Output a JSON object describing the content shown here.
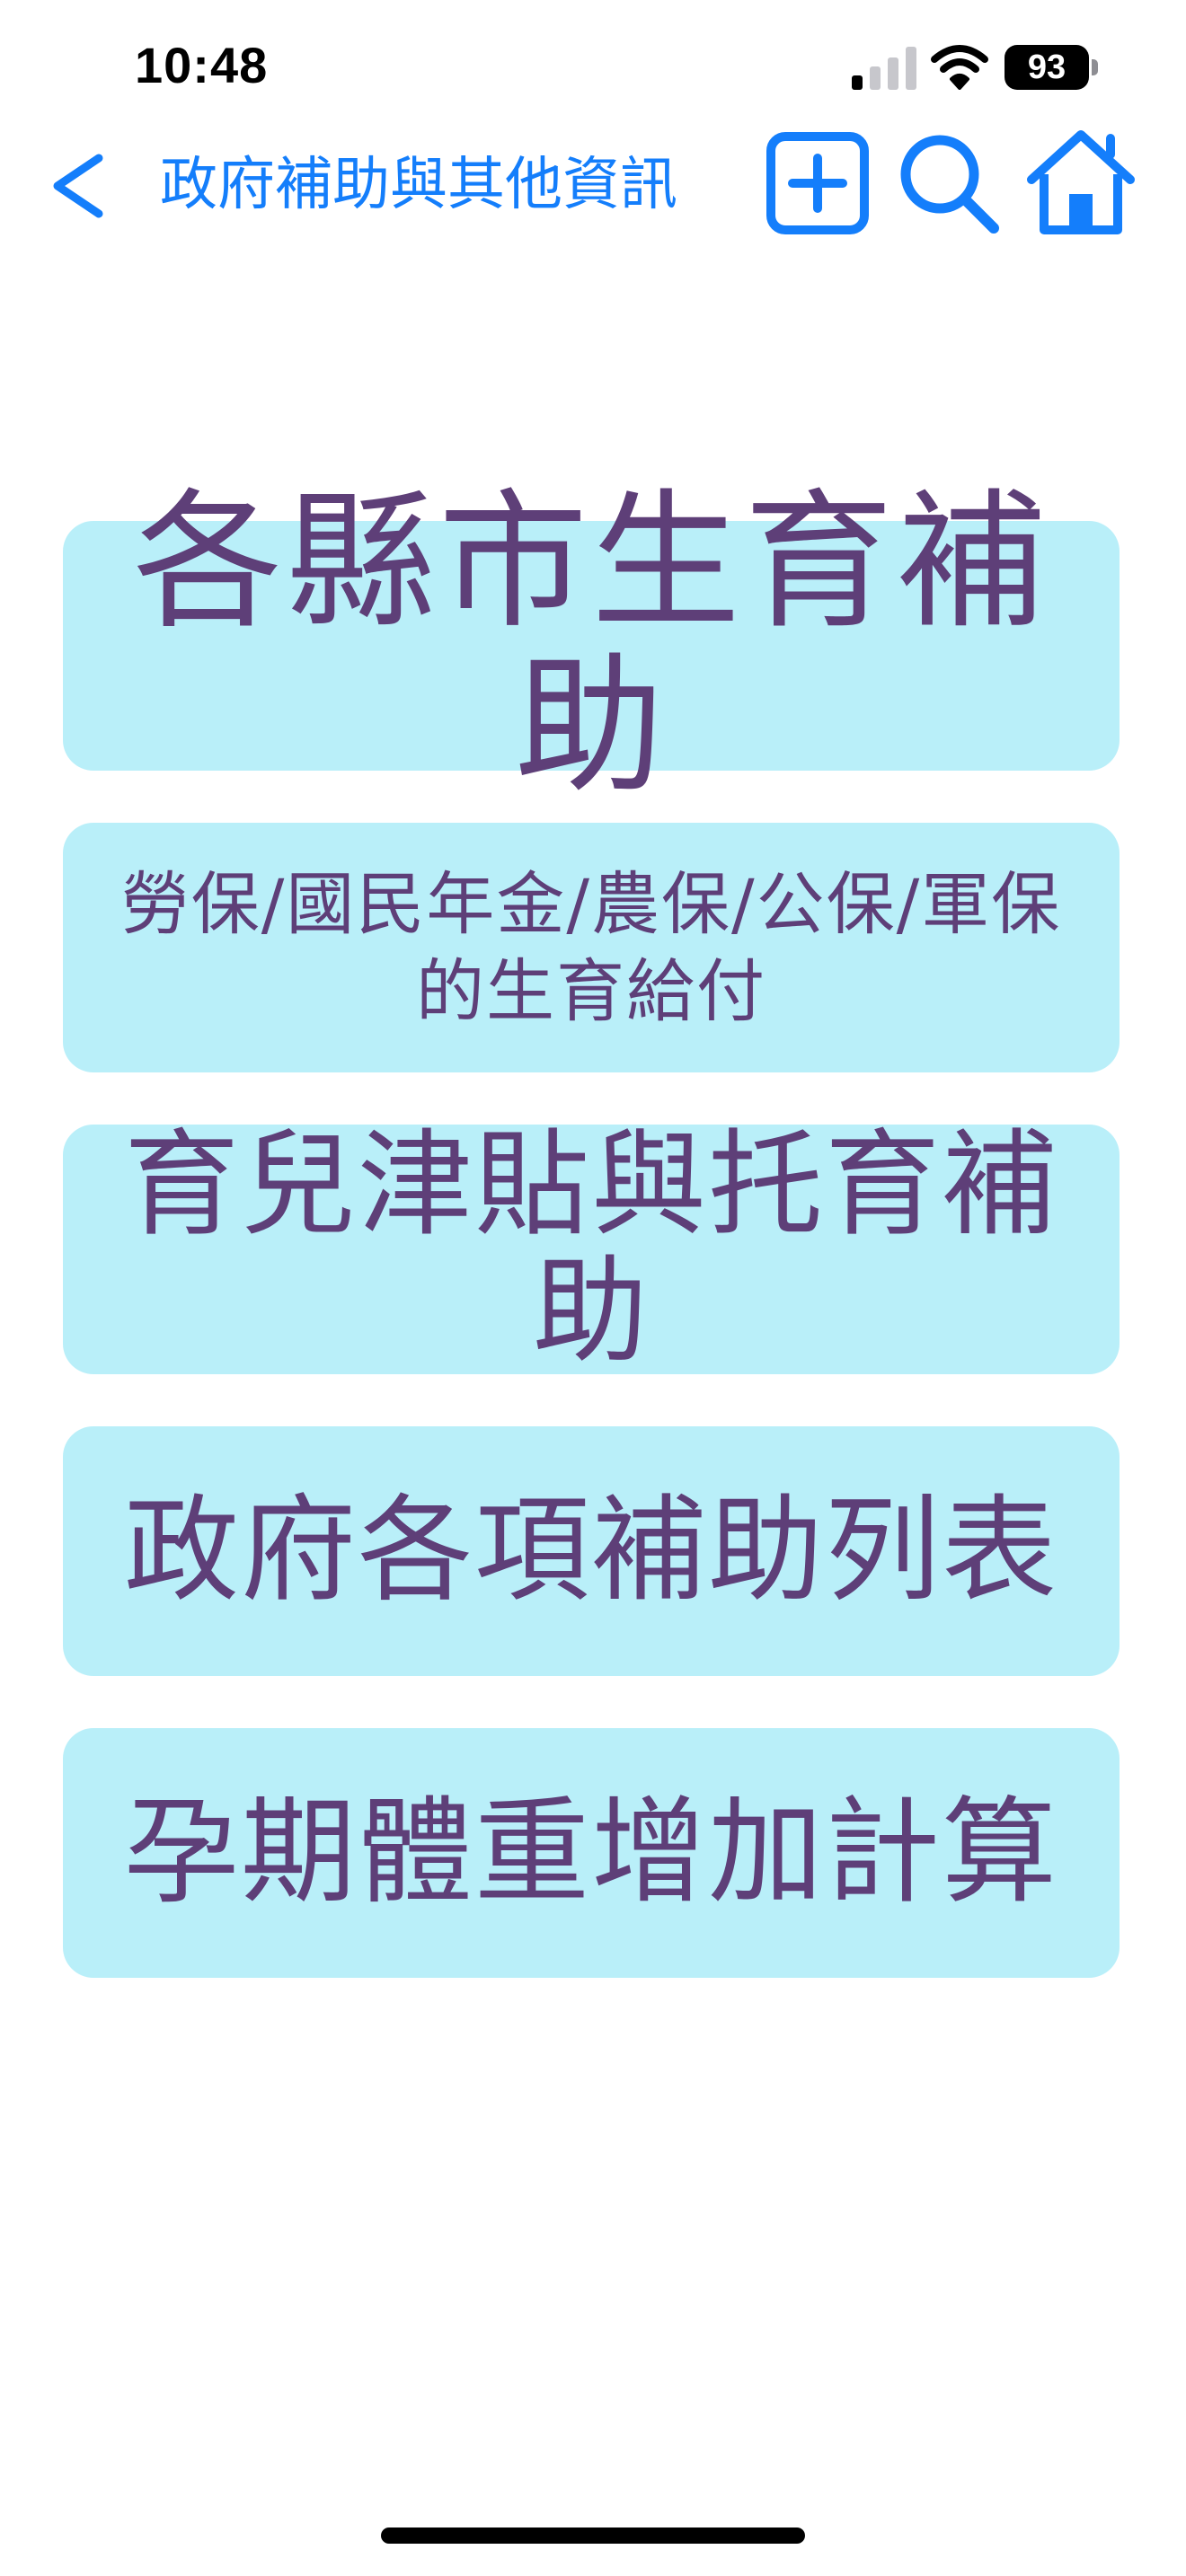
{
  "status_bar": {
    "time": "10:48",
    "battery": "93",
    "icons": [
      "signal-icon",
      "wifi-icon",
      "battery-icon"
    ]
  },
  "nav": {
    "title": "政府補助與其他資訊",
    "icons": [
      "back-chevron-icon",
      "add-square-icon",
      "search-icon",
      "home-icon"
    ],
    "accent_color": "#147efb"
  },
  "menu": {
    "items": [
      {
        "label": "各縣市生育補助"
      },
      {
        "label": "勞保/國民年金/農保/公保/軍保的生育給付"
      },
      {
        "label": "育兒津貼與托育補助"
      },
      {
        "label": "政府各項補助列表"
      },
      {
        "label": "孕期體重增加計算"
      }
    ],
    "button_color": "#b9eff9",
    "text_color": "#5e3f78"
  }
}
